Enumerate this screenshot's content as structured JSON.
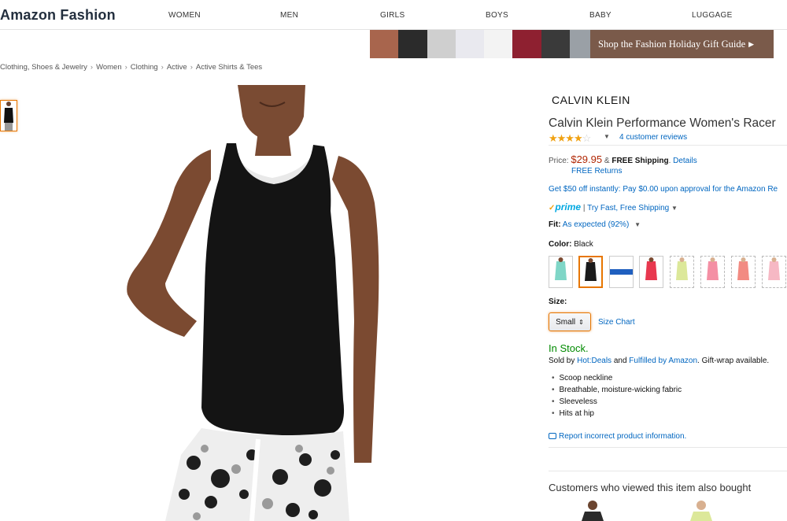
{
  "header": {
    "brand": "Amazon Fashion",
    "nav": [
      "WOMEN",
      "MEN",
      "GIRLS",
      "BOYS",
      "BABY",
      "LUGGAGE"
    ]
  },
  "banner": {
    "cta": "Shop the Fashion Holiday Gift Guide",
    "arrow_icon": "triangle-right"
  },
  "breadcrumb": [
    "Clothing, Shoes & Jewelry",
    "Women",
    "Clothing",
    "Active",
    "Active Shirts & Tees"
  ],
  "product": {
    "brand_logo": "CALVIN KLEIN",
    "title": "Calvin Klein Performance Women's Racer",
    "rating": 4,
    "rating_max": 5,
    "reviews": "4 customer reviews",
    "price_label": "Price:",
    "price": "$29.95",
    "shipping_amp": "&",
    "shipping": "FREE Shipping",
    "shipping_details": "Details",
    "returns": "FREE Returns",
    "promo": "Get $50 off instantly: Pay $0.00 upon approval for the Amazon Re",
    "prime_logo": "prime",
    "prime_sep": "|",
    "prime_text": "Try Fast, Free Shipping",
    "fit_label": "Fit:",
    "fit_value": "As expected (92%)",
    "color_label": "Color:",
    "color_value": "Black",
    "swatches": [
      {
        "name": "mint",
        "color": "#7fd6c7"
      },
      {
        "name": "black",
        "color": "#1a1a1a"
      },
      {
        "name": "white-blue",
        "color": "#1f5fbf"
      },
      {
        "name": "red",
        "color": "#e8384f"
      },
      {
        "name": "lime",
        "color": "#dce89a"
      },
      {
        "name": "pink",
        "color": "#f48fa4"
      },
      {
        "name": "coral",
        "color": "#f28b82"
      },
      {
        "name": "light-pink",
        "color": "#f6b8c4"
      }
    ],
    "size_label": "Size:",
    "size_value": "Small",
    "size_chart": "Size Chart",
    "stock": "In Stock.",
    "sold_by_prefix": "Sold by",
    "sold_by": "Hot:Deals",
    "sold_by_and": "and",
    "fulfilled": "Fulfilled by Amazon",
    "gift_wrap": ". Gift-wrap available.",
    "bullets": [
      "Scoop neckline",
      "Breathable, moisture-wicking fabric",
      "Sleeveless",
      "Hits at hip"
    ],
    "report": "Report incorrect product information.",
    "also_bought": "Customers who viewed this item also bought"
  },
  "colors": {
    "link": "#0066c0",
    "price": "#b12704",
    "stock": "#008a00",
    "selected": "#e77600"
  }
}
